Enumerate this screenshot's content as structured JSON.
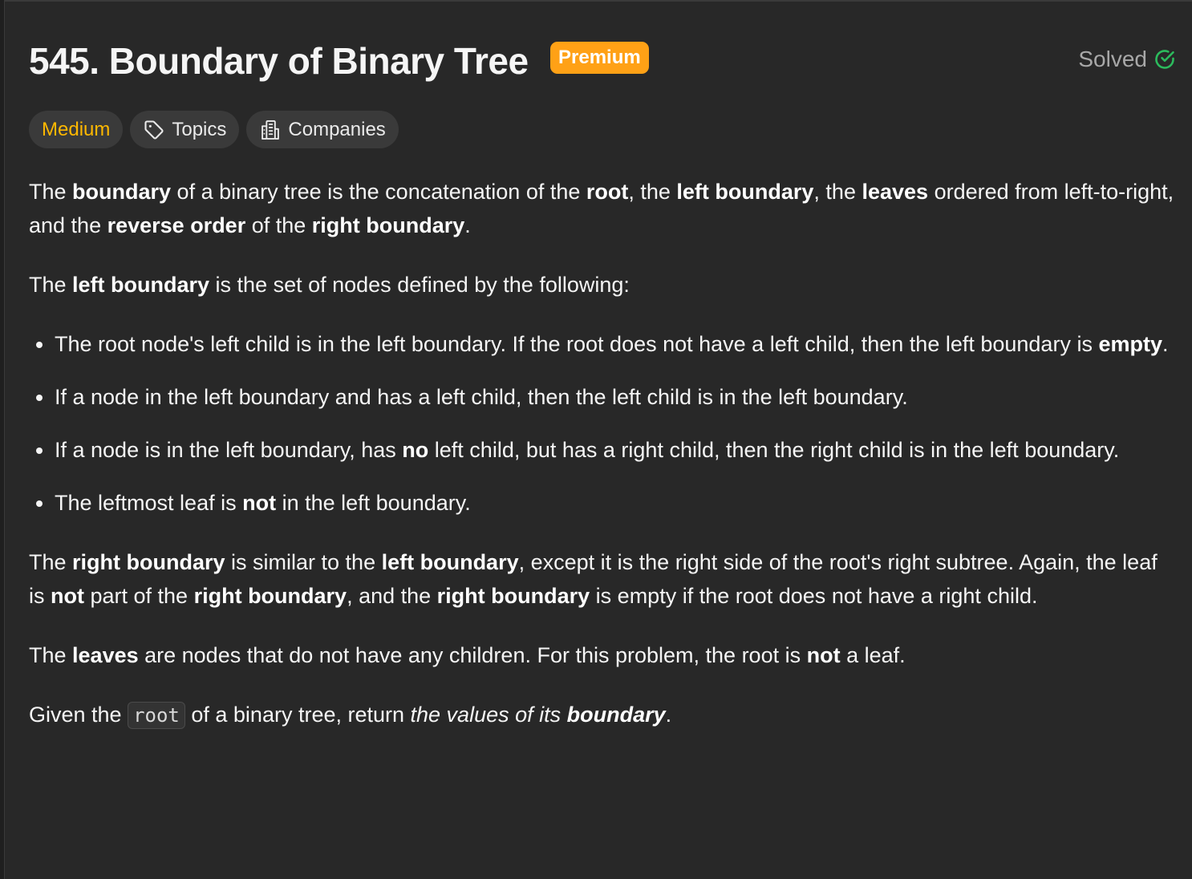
{
  "problem": {
    "title": "545. Boundary of Binary Tree",
    "premium_label": "Premium",
    "solved_label": "Solved"
  },
  "tags": {
    "difficulty": "Medium",
    "topics": "Topics",
    "companies": "Companies"
  },
  "colors": {
    "background": "#282828",
    "premium": "#ffa116",
    "medium": "#ffb800",
    "solved_check": "#2cbb5d"
  },
  "icons": [
    "check-circle-icon",
    "tag-icon",
    "building-icon"
  ],
  "description": {
    "p1": [
      {
        "t": "The "
      },
      {
        "t": "boundary",
        "b": true
      },
      {
        "t": " of a binary tree is the concatenation of the "
      },
      {
        "t": "root",
        "b": true
      },
      {
        "t": ", the "
      },
      {
        "t": "left boundary",
        "b": true
      },
      {
        "t": ", the "
      },
      {
        "t": "leaves",
        "b": true
      },
      {
        "t": " ordered from left-to-right, and the "
      },
      {
        "t": "reverse order",
        "b": true
      },
      {
        "t": " of the "
      },
      {
        "t": "right boundary",
        "b": true
      },
      {
        "t": "."
      }
    ],
    "p2": [
      {
        "t": "The "
      },
      {
        "t": "left boundary",
        "b": true
      },
      {
        "t": " is the set of nodes defined by the following:"
      }
    ],
    "bullets": [
      [
        {
          "t": "The root node's left child is in the left boundary. If the root does not have a left child, then the left boundary is "
        },
        {
          "t": "empty",
          "b": true
        },
        {
          "t": "."
        }
      ],
      [
        {
          "t": "If a node in the left boundary and has a left child, then the left child is in the left boundary."
        }
      ],
      [
        {
          "t": "If a node is in the left boundary, has "
        },
        {
          "t": "no",
          "b": true
        },
        {
          "t": " left child, but has a right child, then the right child is in the left boundary."
        }
      ],
      [
        {
          "t": "The leftmost leaf is "
        },
        {
          "t": "not",
          "b": true
        },
        {
          "t": " in the left boundary."
        }
      ]
    ],
    "p3": [
      {
        "t": "The "
      },
      {
        "t": "right boundary",
        "b": true
      },
      {
        "t": " is similar to the "
      },
      {
        "t": "left boundary",
        "b": true
      },
      {
        "t": ", except it is the right side of the root's right subtree. Again, the leaf is "
      },
      {
        "t": "not",
        "b": true
      },
      {
        "t": " part of the "
      },
      {
        "t": "right boundary",
        "b": true
      },
      {
        "t": ", and the "
      },
      {
        "t": "right boundary",
        "b": true
      },
      {
        "t": " is empty if the root does not have a right child."
      }
    ],
    "p4": [
      {
        "t": "The "
      },
      {
        "t": "leaves",
        "b": true
      },
      {
        "t": " are nodes that do not have any children. For this problem, the root is "
      },
      {
        "t": "not",
        "b": true
      },
      {
        "t": " a leaf."
      }
    ],
    "p5": [
      {
        "t": "Given the "
      },
      {
        "t": "root",
        "code": true
      },
      {
        "t": " of a binary tree, return "
      },
      {
        "t": "the values of its ",
        "i": true
      },
      {
        "t": "boundary",
        "i": true,
        "b": true
      },
      {
        "t": "."
      }
    ]
  }
}
